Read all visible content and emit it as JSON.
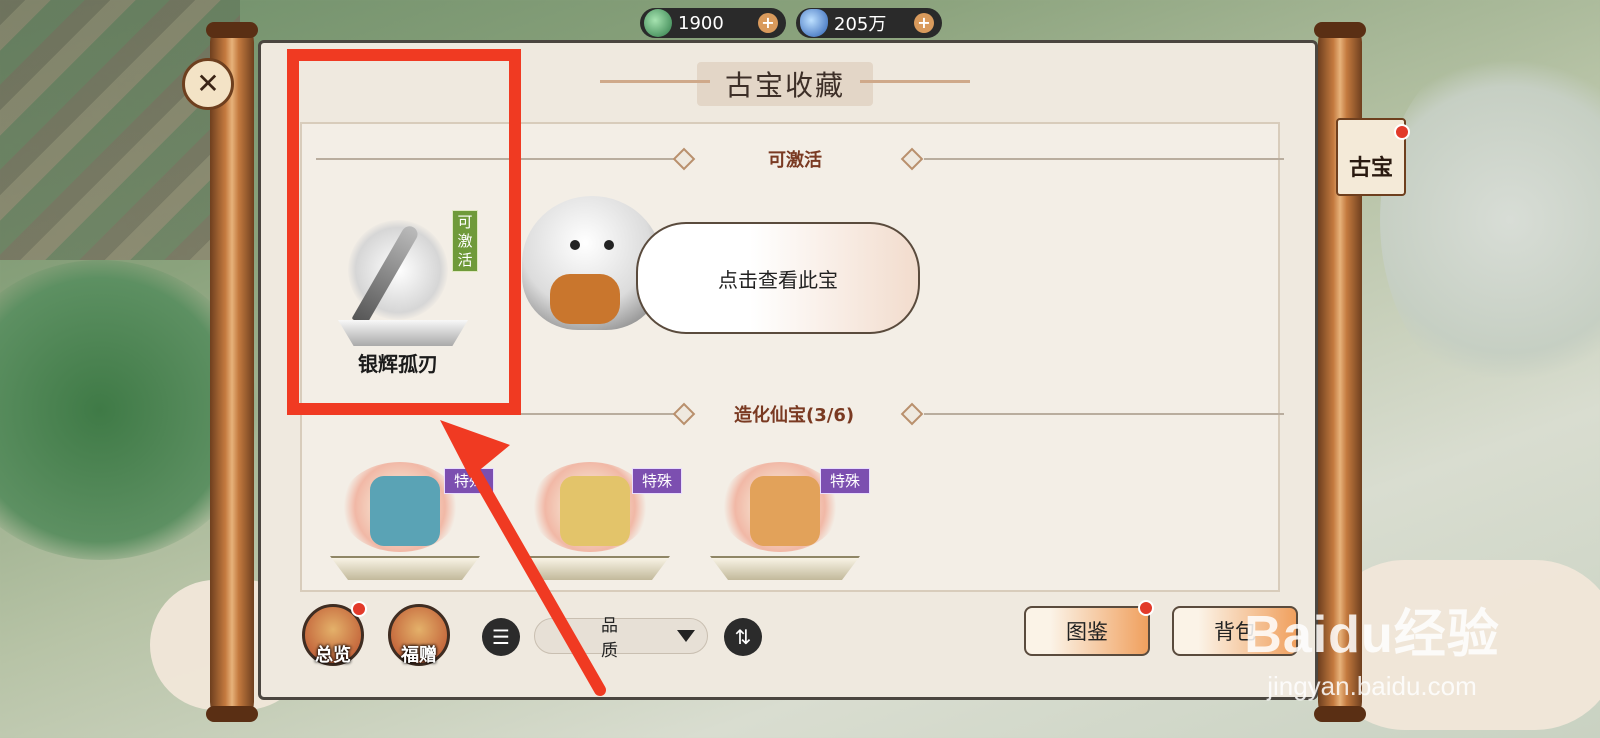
{
  "currency": {
    "jade": {
      "value": "1900",
      "icon": "jade-coin-icon"
    },
    "crystal": {
      "value": "205万",
      "icon": "blue-crystal-icon"
    }
  },
  "panel": {
    "title": "古宝收藏"
  },
  "sections": {
    "activatable": {
      "title": "可激活"
    },
    "creation": {
      "title": "造化仙宝(3/6)"
    }
  },
  "featured_item": {
    "name": "银辉孤刃",
    "tag": "可激活"
  },
  "hint": {
    "text": "点击查看此宝"
  },
  "special_items": [
    {
      "badge": "特殊",
      "color": "#5aa3b5"
    },
    {
      "badge": "特殊",
      "color": "#e3c46a"
    },
    {
      "badge": "特殊",
      "color": "#e2a25a"
    }
  ],
  "side_tab": {
    "label": "古宝"
  },
  "bottom_bar": {
    "overview": "总览",
    "gift": "福赠",
    "sort_select": "品质",
    "codex": "图鉴",
    "bag": "背包"
  },
  "watermark": {
    "logo": "Baidu经验",
    "url": "jingyan.baidu.com"
  },
  "colors": {
    "highlight": "#f03a22",
    "accent_purple": "#7c4fb0",
    "activate_green": "#6f9a3a"
  }
}
